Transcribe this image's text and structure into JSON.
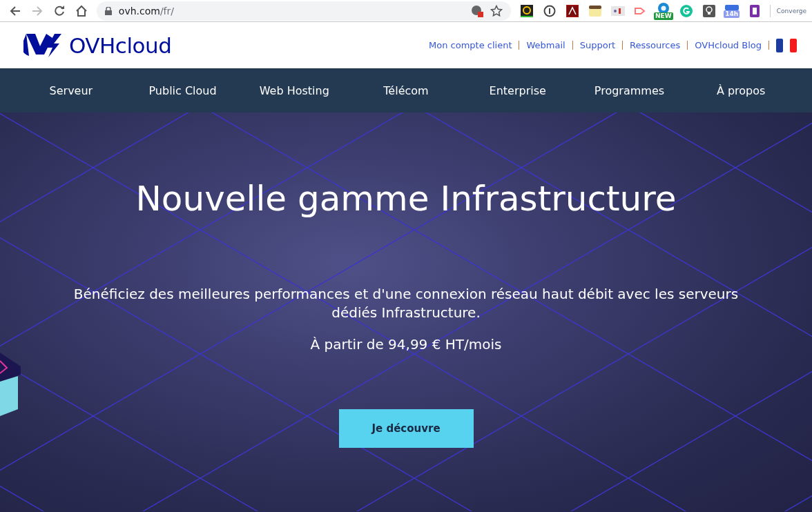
{
  "browser": {
    "url_host": "ovh.com",
    "url_path": "/fr/",
    "new_badge": "NEW",
    "timer_badge": "14h",
    "profile_label": "Converge"
  },
  "header": {
    "logo_text": "OVHcloud",
    "links": [
      "Mon compte client",
      "Webmail",
      "Support",
      "Ressources",
      "OVHcloud Blog"
    ]
  },
  "nav": {
    "items": [
      "Serveur",
      "Public Cloud",
      "Web Hosting",
      "Télécom",
      "Enterprise",
      "Programmes",
      "À propos"
    ]
  },
  "hero": {
    "title": "Nouvelle gamme Infrastructure",
    "subtitle": "Bénéficiez des meilleures performances et d'une connexion réseau haut débit avec les serveurs dédiés Infrastructure.",
    "price": "À partir de 94,99 € HT/mois",
    "button": "Je découvre"
  }
}
